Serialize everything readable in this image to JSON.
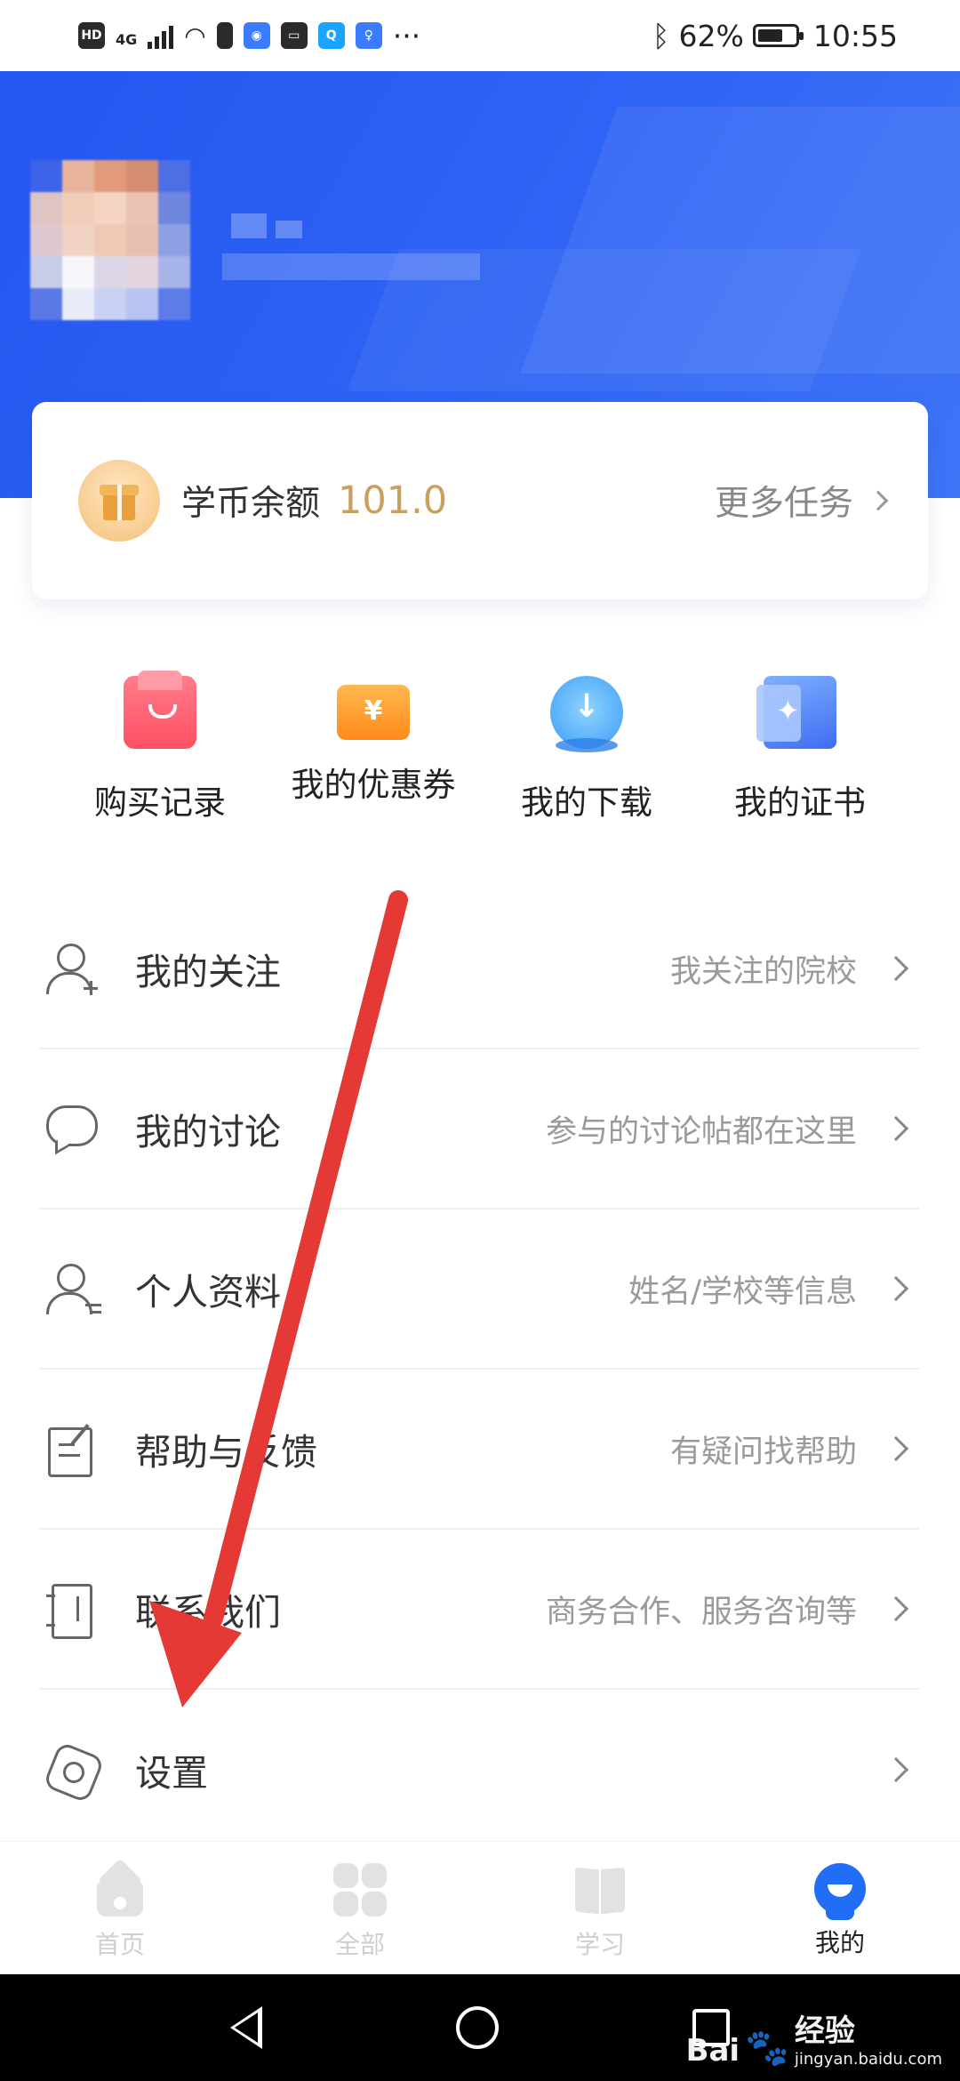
{
  "status_bar": {
    "left_labels": [
      "HD",
      "4G"
    ],
    "battery": "62%",
    "time": "10:55",
    "more": "···"
  },
  "coin_card": {
    "label": "学币余额",
    "value": "101.0",
    "more_tasks": "更多任务"
  },
  "quick_actions": [
    {
      "label": "购买记录",
      "icon": "shopping-bag-icon"
    },
    {
      "label": "我的优惠券",
      "icon": "coupon-icon",
      "glyph": "¥"
    },
    {
      "label": "我的下载",
      "icon": "download-cloud-icon",
      "glyph": "↓"
    },
    {
      "label": "我的证书",
      "icon": "certificate-icon",
      "glyph": "✦"
    }
  ],
  "menu": [
    {
      "title": "我的关注",
      "subtitle": "我关注的院校",
      "icon": "user-plus-icon"
    },
    {
      "title": "我的讨论",
      "subtitle": "参与的讨论帖都在这里",
      "icon": "chat-bubble-icon"
    },
    {
      "title": "个人资料",
      "subtitle": "姓名/学校等信息",
      "icon": "user-profile-icon"
    },
    {
      "title": "帮助与反馈",
      "subtitle": "有疑问找帮助",
      "icon": "feedback-icon"
    },
    {
      "title": "联系我们",
      "subtitle": "商务合作、服务咨询等",
      "icon": "contact-book-icon"
    },
    {
      "title": "设置",
      "subtitle": "",
      "icon": "settings-gear-icon"
    }
  ],
  "tabs": [
    {
      "label": "首页",
      "active": false
    },
    {
      "label": "全部",
      "active": false
    },
    {
      "label": "学习",
      "active": false
    },
    {
      "label": "我的",
      "active": true
    }
  ],
  "watermark": {
    "brand": "Bai",
    "brand2": "经验",
    "url": "jingyan.baidu.com"
  },
  "colors": {
    "header_blue": "#2456f0",
    "coin_gold": "#c9a15e",
    "annotation_arrow": "#e53935",
    "active_tab": "#1f6ef5"
  }
}
